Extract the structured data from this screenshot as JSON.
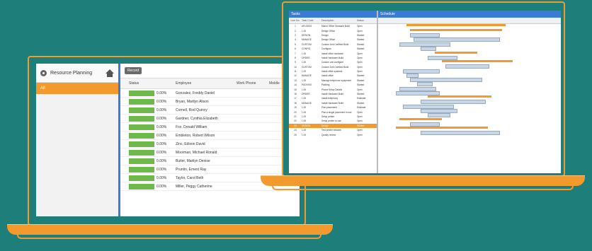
{
  "left_app": {
    "title": "Resource Planning",
    "sidebar_selected": "All",
    "toolbar_button": "Record",
    "columns": [
      "Status",
      "Employee",
      "Work Phone",
      "Mobile"
    ],
    "rows": [
      {
        "status": "0.00%",
        "employee": "Gonzalez, Freddy Daniel"
      },
      {
        "status": "0.00%",
        "employee": "Bryan, Marilyn Alison"
      },
      {
        "status": "0.00%",
        "employee": "Cornell, Rod Quincy"
      },
      {
        "status": "0.00%",
        "employee": "Gardner, Cynthia Elizabeth"
      },
      {
        "status": "0.00%",
        "employee": "Fox, Donald William"
      },
      {
        "status": "0.00%",
        "employee": "Embleton, Robert Wilson"
      },
      {
        "status": "0.00%",
        "employee": "Zinc, Edison David"
      },
      {
        "status": "0.00%",
        "employee": "Moorman, Michael Ronald"
      },
      {
        "status": "0.00%",
        "employee": "Butler, Marilyn Denise"
      },
      {
        "status": "0.00%",
        "employee": "Pruntin, Ernest Ray"
      },
      {
        "status": "0.00%",
        "employee": "Taylor, Carol Beth"
      },
      {
        "status": "0.00%",
        "employee": "Miller, Peggy Catherine"
      }
    ]
  },
  "right_app": {
    "tasks_title": "Tasks",
    "schedule_title": "Schedule",
    "columns": [
      "Line No.",
      "Task Code",
      "Description",
      "Status"
    ],
    "rows": [
      {
        "id": "1",
        "code": "AR-00001",
        "desc": "Manor Office Standard Build",
        "status": "Open"
      },
      {
        "id": "2",
        "code": "1.00",
        "desc": "Design Office",
        "status": "Open"
      },
      {
        "id": "3",
        "code": "DESIGN",
        "desc": "Design",
        "status": "Started"
      },
      {
        "id": "4",
        "code": "MANAGE",
        "desc": "Design Office",
        "status": "Started"
      },
      {
        "id": "5",
        "code": "CUSTOM",
        "desc": "Custom Unit Certified Build",
        "status": "Started"
      },
      {
        "id": "6",
        "code": "CONFIG",
        "desc": "Configure",
        "status": "Started"
      },
      {
        "id": "7",
        "code": "1.00",
        "desc": "Install office hardware",
        "status": "Open"
      },
      {
        "id": "8",
        "code": "ORDER",
        "desc": "Install Hardware Build",
        "status": "Open"
      },
      {
        "id": "9",
        "code": "1.00",
        "desc": "Custom unit configure",
        "status": "Open"
      },
      {
        "id": "10",
        "code": "CUSTOM",
        "desc": "Custom Unit Certified Build",
        "status": "Open"
      },
      {
        "id": "11",
        "code": "1.00",
        "desc": "Install office systems",
        "status": "Open"
      },
      {
        "id": "12",
        "code": "MANAGE",
        "desc": "Install office",
        "status": "Started"
      },
      {
        "id": "13",
        "code": "1.00",
        "desc": "Manage telephone equipment",
        "status": "Started"
      },
      {
        "id": "14",
        "code": "PACKING",
        "desc": "Packing",
        "status": "Started"
      },
      {
        "id": "15",
        "code": "1.00",
        "desc": "Phone Setup Details",
        "status": "Open"
      },
      {
        "id": "16",
        "code": "ORDER",
        "desc": "Install Hardware Build",
        "status": "Started"
      },
      {
        "id": "17",
        "code": "1.00",
        "desc": "Install telephony",
        "status": "Estimate"
      },
      {
        "id": "18",
        "code": "MANAGE",
        "desc": "Install Hardware Build",
        "status": "Started"
      },
      {
        "id": "19",
        "code": "1.00",
        "desc": "Plan placement",
        "status": "Estimate"
      },
      {
        "id": "20",
        "code": "1.00",
        "desc": "Plan a single pavement in use",
        "status": "Open"
      },
      {
        "id": "21",
        "code": "1.00",
        "desc": "Setup printer",
        "status": "Open"
      },
      {
        "id": "22",
        "code": "1.00",
        "desc": "Setup printer to use",
        "status": "Open"
      },
      {
        "id": "23",
        "code": "DESIGN",
        "desc": "Design",
        "status": "Started"
      },
      {
        "id": "24",
        "code": "1.00",
        "desc": "Test printer network",
        "status": "Open"
      },
      {
        "id": "25",
        "code": "1.00",
        "desc": "Quality review",
        "status": "Open"
      }
    ],
    "selected_row": 23
  }
}
